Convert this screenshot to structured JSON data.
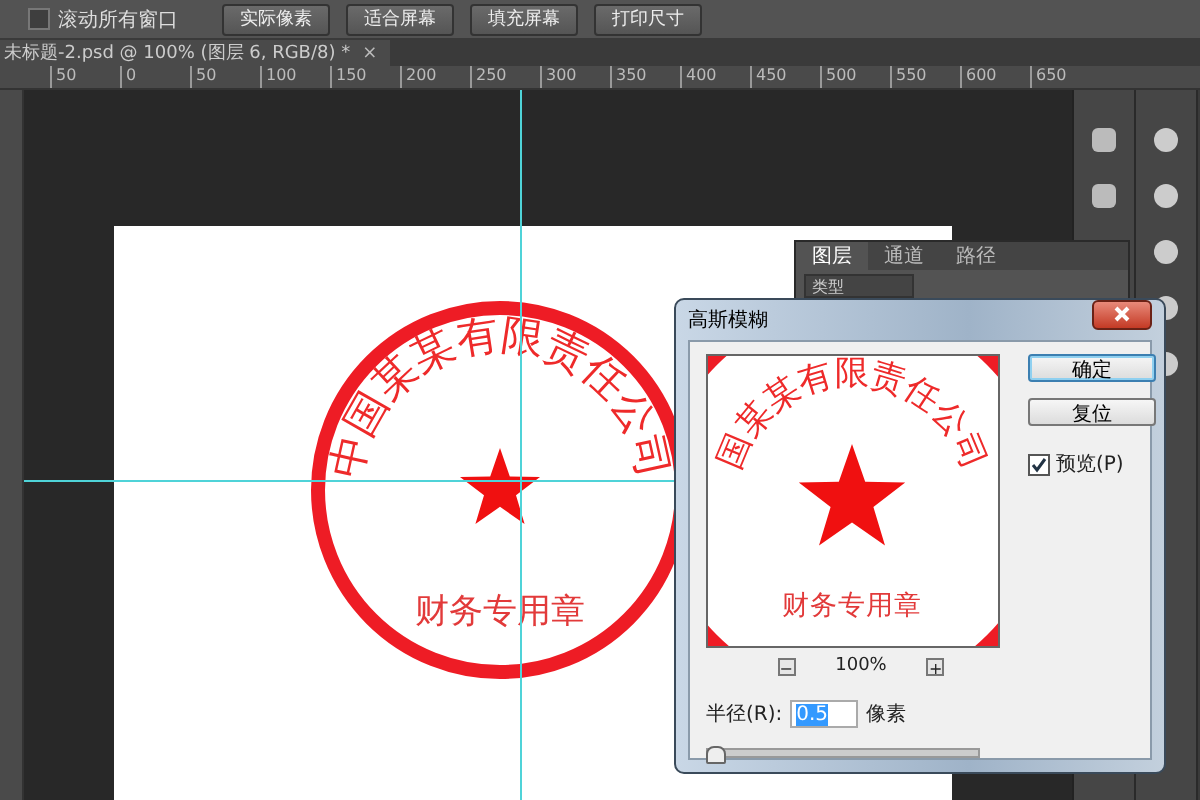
{
  "options_bar": {
    "scroll_all": {
      "label": "滚动所有窗口",
      "checked": false
    },
    "buttons": [
      "实际像素",
      "适合屏幕",
      "填充屏幕",
      "打印尺寸"
    ]
  },
  "document_tab": {
    "title": "未标题-2.psd @ 100% (图层 6, RGB/8) *",
    "close": "×"
  },
  "ruler": {
    "ticks": [
      "50",
      "0",
      "50",
      "100",
      "150",
      "200",
      "250",
      "300",
      "350",
      "400",
      "450",
      "500",
      "550",
      "600",
      "650"
    ]
  },
  "stamp": {
    "arc_text": "中国某某有限责任公司",
    "bottom_text": "财务专用章"
  },
  "layers_panel": {
    "tabs": [
      {
        "label": "图层",
        "selected": true
      },
      {
        "label": "通道",
        "selected": false
      },
      {
        "label": "路径",
        "selected": false
      }
    ],
    "filter": "类型"
  },
  "dialog": {
    "title": "高斯模糊",
    "preview_arc_text": "国某某有限责任公司",
    "preview_bottom_text": "财务专用章",
    "zoom_out": "−",
    "zoom": "100%",
    "zoom_in": "+",
    "buttons": [
      {
        "label": "确定",
        "default": true
      },
      {
        "label": "复位",
        "default": false
      }
    ],
    "preview_option": {
      "label": "预览(P)",
      "checked": true
    },
    "radius": {
      "label": "半径(R):",
      "value": "0.5",
      "unit": "像素",
      "level": 0.02
    }
  }
}
